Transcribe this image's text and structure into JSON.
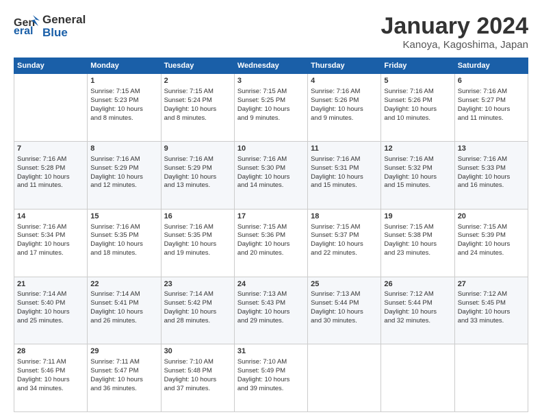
{
  "header": {
    "logo_line1": "General",
    "logo_line2": "Blue",
    "month_title": "January 2024",
    "subtitle": "Kanoya, Kagoshima, Japan"
  },
  "days_of_week": [
    "Sunday",
    "Monday",
    "Tuesday",
    "Wednesday",
    "Thursday",
    "Friday",
    "Saturday"
  ],
  "weeks": [
    [
      {
        "day": "",
        "info": ""
      },
      {
        "day": "1",
        "info": "Sunrise: 7:15 AM\nSunset: 5:23 PM\nDaylight: 10 hours\nand 8 minutes."
      },
      {
        "day": "2",
        "info": "Sunrise: 7:15 AM\nSunset: 5:24 PM\nDaylight: 10 hours\nand 8 minutes."
      },
      {
        "day": "3",
        "info": "Sunrise: 7:15 AM\nSunset: 5:25 PM\nDaylight: 10 hours\nand 9 minutes."
      },
      {
        "day": "4",
        "info": "Sunrise: 7:16 AM\nSunset: 5:26 PM\nDaylight: 10 hours\nand 9 minutes."
      },
      {
        "day": "5",
        "info": "Sunrise: 7:16 AM\nSunset: 5:26 PM\nDaylight: 10 hours\nand 10 minutes."
      },
      {
        "day": "6",
        "info": "Sunrise: 7:16 AM\nSunset: 5:27 PM\nDaylight: 10 hours\nand 11 minutes."
      }
    ],
    [
      {
        "day": "7",
        "info": "Sunrise: 7:16 AM\nSunset: 5:28 PM\nDaylight: 10 hours\nand 11 minutes."
      },
      {
        "day": "8",
        "info": "Sunrise: 7:16 AM\nSunset: 5:29 PM\nDaylight: 10 hours\nand 12 minutes."
      },
      {
        "day": "9",
        "info": "Sunrise: 7:16 AM\nSunset: 5:29 PM\nDaylight: 10 hours\nand 13 minutes."
      },
      {
        "day": "10",
        "info": "Sunrise: 7:16 AM\nSunset: 5:30 PM\nDaylight: 10 hours\nand 14 minutes."
      },
      {
        "day": "11",
        "info": "Sunrise: 7:16 AM\nSunset: 5:31 PM\nDaylight: 10 hours\nand 15 minutes."
      },
      {
        "day": "12",
        "info": "Sunrise: 7:16 AM\nSunset: 5:32 PM\nDaylight: 10 hours\nand 15 minutes."
      },
      {
        "day": "13",
        "info": "Sunrise: 7:16 AM\nSunset: 5:33 PM\nDaylight: 10 hours\nand 16 minutes."
      }
    ],
    [
      {
        "day": "14",
        "info": "Sunrise: 7:16 AM\nSunset: 5:34 PM\nDaylight: 10 hours\nand 17 minutes."
      },
      {
        "day": "15",
        "info": "Sunrise: 7:16 AM\nSunset: 5:35 PM\nDaylight: 10 hours\nand 18 minutes."
      },
      {
        "day": "16",
        "info": "Sunrise: 7:16 AM\nSunset: 5:35 PM\nDaylight: 10 hours\nand 19 minutes."
      },
      {
        "day": "17",
        "info": "Sunrise: 7:15 AM\nSunset: 5:36 PM\nDaylight: 10 hours\nand 20 minutes."
      },
      {
        "day": "18",
        "info": "Sunrise: 7:15 AM\nSunset: 5:37 PM\nDaylight: 10 hours\nand 22 minutes."
      },
      {
        "day": "19",
        "info": "Sunrise: 7:15 AM\nSunset: 5:38 PM\nDaylight: 10 hours\nand 23 minutes."
      },
      {
        "day": "20",
        "info": "Sunrise: 7:15 AM\nSunset: 5:39 PM\nDaylight: 10 hours\nand 24 minutes."
      }
    ],
    [
      {
        "day": "21",
        "info": "Sunrise: 7:14 AM\nSunset: 5:40 PM\nDaylight: 10 hours\nand 25 minutes."
      },
      {
        "day": "22",
        "info": "Sunrise: 7:14 AM\nSunset: 5:41 PM\nDaylight: 10 hours\nand 26 minutes."
      },
      {
        "day": "23",
        "info": "Sunrise: 7:14 AM\nSunset: 5:42 PM\nDaylight: 10 hours\nand 28 minutes."
      },
      {
        "day": "24",
        "info": "Sunrise: 7:13 AM\nSunset: 5:43 PM\nDaylight: 10 hours\nand 29 minutes."
      },
      {
        "day": "25",
        "info": "Sunrise: 7:13 AM\nSunset: 5:44 PM\nDaylight: 10 hours\nand 30 minutes."
      },
      {
        "day": "26",
        "info": "Sunrise: 7:12 AM\nSunset: 5:44 PM\nDaylight: 10 hours\nand 32 minutes."
      },
      {
        "day": "27",
        "info": "Sunrise: 7:12 AM\nSunset: 5:45 PM\nDaylight: 10 hours\nand 33 minutes."
      }
    ],
    [
      {
        "day": "28",
        "info": "Sunrise: 7:11 AM\nSunset: 5:46 PM\nDaylight: 10 hours\nand 34 minutes."
      },
      {
        "day": "29",
        "info": "Sunrise: 7:11 AM\nSunset: 5:47 PM\nDaylight: 10 hours\nand 36 minutes."
      },
      {
        "day": "30",
        "info": "Sunrise: 7:10 AM\nSunset: 5:48 PM\nDaylight: 10 hours\nand 37 minutes."
      },
      {
        "day": "31",
        "info": "Sunrise: 7:10 AM\nSunset: 5:49 PM\nDaylight: 10 hours\nand 39 minutes."
      },
      {
        "day": "",
        "info": ""
      },
      {
        "day": "",
        "info": ""
      },
      {
        "day": "",
        "info": ""
      }
    ]
  ]
}
